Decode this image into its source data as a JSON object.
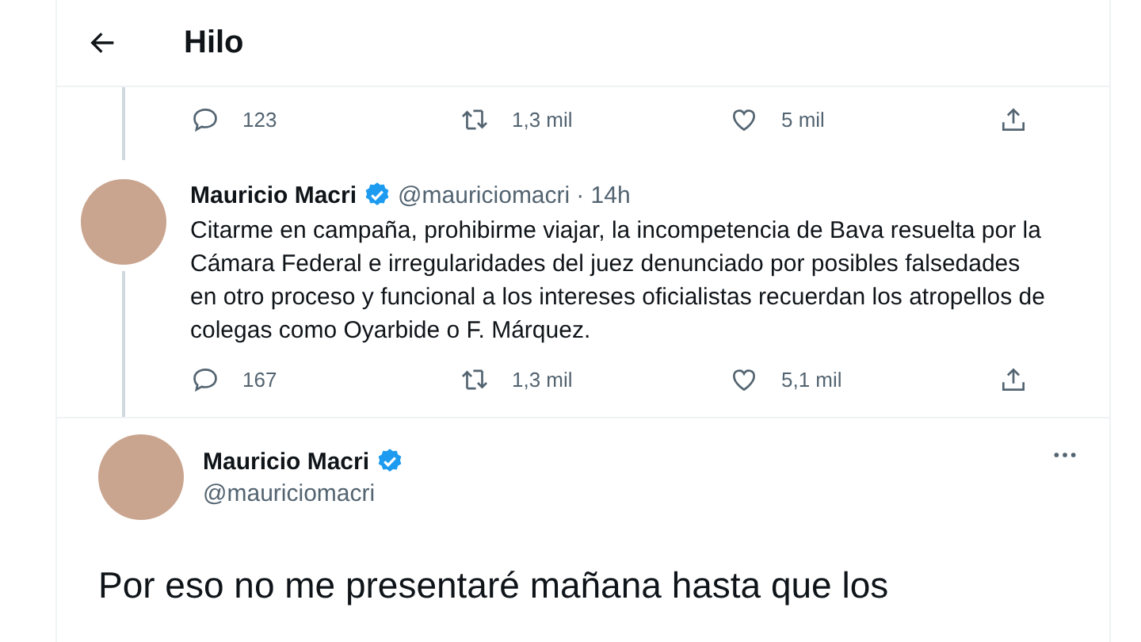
{
  "header": {
    "title": "Hilo"
  },
  "previous_tweet": {
    "actions": [
      {
        "kind": "reply",
        "count": "123"
      },
      {
        "kind": "retweet",
        "count": "1,3 mil"
      },
      {
        "kind": "like",
        "count": "5 mil"
      },
      {
        "kind": "share"
      }
    ]
  },
  "tweets": [
    {
      "kind": "thread",
      "name": "Mauricio Macri",
      "verified": true,
      "handle": "@mauriciomacri",
      "time": "· 14h",
      "text": "Citarme en campaña, prohibirme viajar, la incompetencia de Bava resuelta por la Cámara Federal e irregularidades del juez denunciado por posibles falsedades en otro proceso y funcional a los intereses oficialistas recuerdan los atropellos de colegas como Oyarbide o F. Márquez.",
      "actions": [
        {
          "kind": "reply",
          "count": "167"
        },
        {
          "kind": "retweet",
          "count": "1,3 mil"
        },
        {
          "kind": "like",
          "count": "5,1 mil"
        },
        {
          "kind": "share"
        }
      ]
    },
    {
      "kind": "focused",
      "name": "Mauricio Macri",
      "verified": true,
      "handle": "@mauriciomacri",
      "text": "Por eso no me presentaré mañana hasta que los"
    }
  ]
}
